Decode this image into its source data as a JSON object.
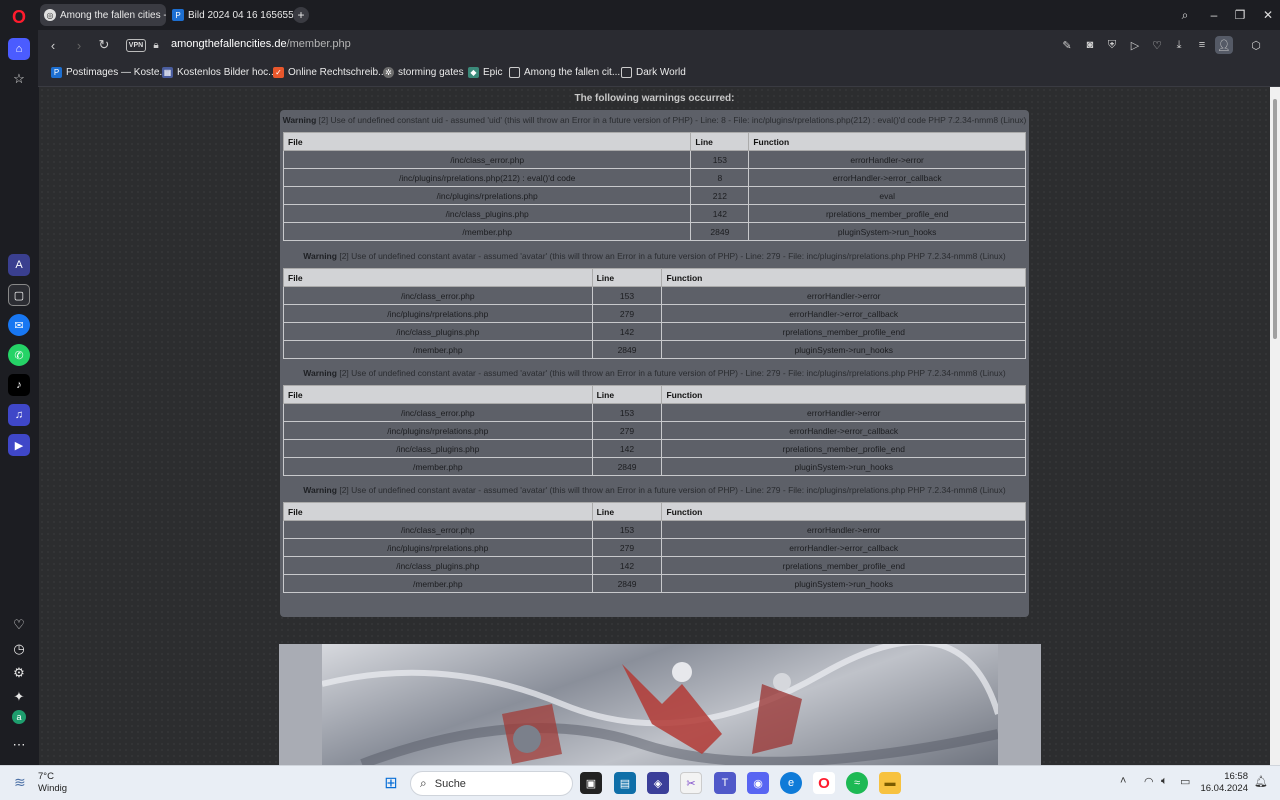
{
  "browser": {
    "tabs": [
      {
        "title": "Among the fallen cities - F"
      },
      {
        "title": "Bild 2024 04 16 16565594"
      }
    ],
    "new_tab_symbol": "+",
    "address": {
      "domain": "amongthefallencities.de",
      "path": "/member.php",
      "vpn_label": "VPN"
    },
    "bookmarks": [
      {
        "label": "Postimages — Koste..."
      },
      {
        "label": "Kostenlos Bilder hoc..."
      },
      {
        "label": "Online Rechtschreib..."
      },
      {
        "label": "storming gates"
      },
      {
        "label": "Epic"
      },
      {
        "label": "Among the fallen cit..."
      },
      {
        "label": "Dark World"
      }
    ]
  },
  "page": {
    "warnings_title": "The following warnings occurred:",
    "warning_word": "Warning",
    "warnings": [
      {
        "text": "[2] Use of undefined constant uid - assumed 'uid' (this will throw an Error in a future version of PHP) - Line: 8 - File: inc/plugins/rprelations.php(212) : eval()'d code PHP 7.2.34-nmm8 (Linux)",
        "headers": [
          "File",
          "Line",
          "Function"
        ],
        "rows": [
          [
            "/inc/class_error.php",
            "153",
            "errorHandler->error"
          ],
          [
            "/inc/plugins/rprelations.php(212) : eval()'d code",
            "8",
            "errorHandler->error_callback"
          ],
          [
            "/inc/plugins/rprelations.php",
            "212",
            "eval"
          ],
          [
            "/inc/class_plugins.php",
            "142",
            "rprelations_member_profile_end"
          ],
          [
            "/member.php",
            "2849",
            "pluginSystem->run_hooks"
          ]
        ]
      },
      {
        "text": "[2] Use of undefined constant avatar - assumed 'avatar' (this will throw an Error in a future version of PHP) - Line: 279 - File: inc/plugins/rprelations.php PHP 7.2.34-nmm8 (Linux)",
        "headers": [
          "File",
          "Line",
          "Function"
        ],
        "rows": [
          [
            "/inc/class_error.php",
            "153",
            "errorHandler->error"
          ],
          [
            "/inc/plugins/rprelations.php",
            "279",
            "errorHandler->error_callback"
          ],
          [
            "/inc/class_plugins.php",
            "142",
            "rprelations_member_profile_end"
          ],
          [
            "/member.php",
            "2849",
            "pluginSystem->run_hooks"
          ]
        ]
      },
      {
        "text": "[2] Use of undefined constant avatar - assumed 'avatar' (this will throw an Error in a future version of PHP) - Line: 279 - File: inc/plugins/rprelations.php PHP 7.2.34-nmm8 (Linux)",
        "headers": [
          "File",
          "Line",
          "Function"
        ],
        "rows": [
          [
            "/inc/class_error.php",
            "153",
            "errorHandler->error"
          ],
          [
            "/inc/plugins/rprelations.php",
            "279",
            "errorHandler->error_callback"
          ],
          [
            "/inc/class_plugins.php",
            "142",
            "rprelations_member_profile_end"
          ],
          [
            "/member.php",
            "2849",
            "pluginSystem->run_hooks"
          ]
        ]
      },
      {
        "text": "[2] Use of undefined constant avatar - assumed 'avatar' (this will throw an Error in a future version of PHP) - Line: 279 - File: inc/plugins/rprelations.php PHP 7.2.34-nmm8 (Linux)",
        "headers": [
          "File",
          "Line",
          "Function"
        ],
        "rows": [
          [
            "/inc/class_error.php",
            "153",
            "errorHandler->error"
          ],
          [
            "/inc/plugins/rprelations.php",
            "279",
            "errorHandler->error_callback"
          ],
          [
            "/inc/class_plugins.php",
            "142",
            "rprelations_member_profile_end"
          ],
          [
            "/member.php",
            "2849",
            "pluginSystem->run_hooks"
          ]
        ]
      }
    ]
  },
  "taskbar": {
    "weather_temp": "7°C",
    "weather_desc": "Windig",
    "search_placeholder": "Suche",
    "time": "16:58",
    "date": "16.04.2024"
  },
  "colors": {
    "opera_red": "#ff1b2d",
    "sidebar_active": "#4b5cff",
    "warning_box": "#5d6068"
  }
}
